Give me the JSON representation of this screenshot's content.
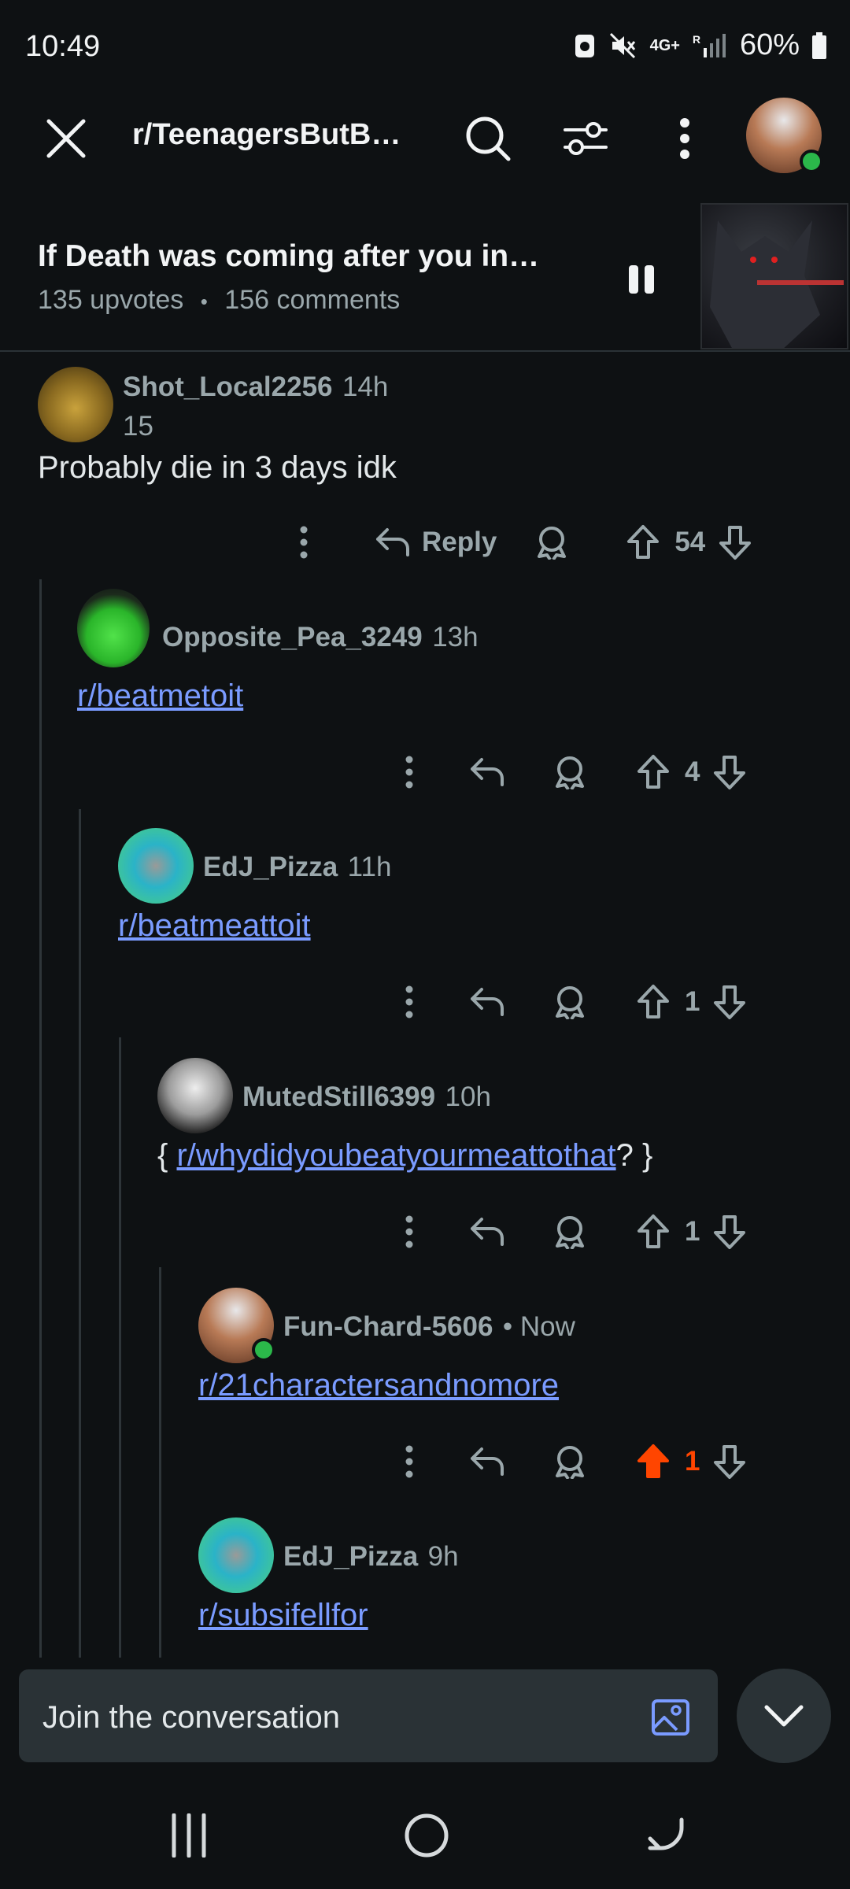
{
  "status": {
    "time": "10:49",
    "network": "4G+",
    "battery": "60%"
  },
  "nav": {
    "subreddit": "r/TeenagersButB…"
  },
  "post": {
    "title": "If Death was coming after you in…",
    "upvotes": "135 upvotes",
    "dot": "•",
    "comments": "156 comments"
  },
  "comments": [
    {
      "user": "Shot_Local2256",
      "time": "14h",
      "flair": "15",
      "body": "Probably die in 3 days idk",
      "reply_label": "Reply",
      "votes": "54"
    },
    {
      "user": "Opposite_Pea_3249",
      "time": "13h",
      "body": "r/beatmetoit",
      "votes": "4"
    },
    {
      "user": "EdJ_Pizza",
      "time": "11h",
      "body": "r/beatmeattoit",
      "votes": "1"
    },
    {
      "user": "MutedStill6399",
      "time": "10h",
      "body_prefix": "{ ",
      "body": "r/whydidyoubeatyourmeattothat",
      "body_suffix": "? }",
      "votes": "1"
    },
    {
      "user": "Fun-Chard-5606",
      "time": "• Now",
      "body": "r/21charactersandnomore",
      "votes": "1"
    },
    {
      "user": "EdJ_Pizza",
      "time": "9h",
      "body": "r/subsifellfor"
    }
  ],
  "composer": {
    "placeholder": "Join the conversation"
  },
  "colors": {
    "background": "#0e1113",
    "link": "#7a9bff",
    "upvoted": "#ff4500",
    "muted": "#9aa7ab"
  }
}
